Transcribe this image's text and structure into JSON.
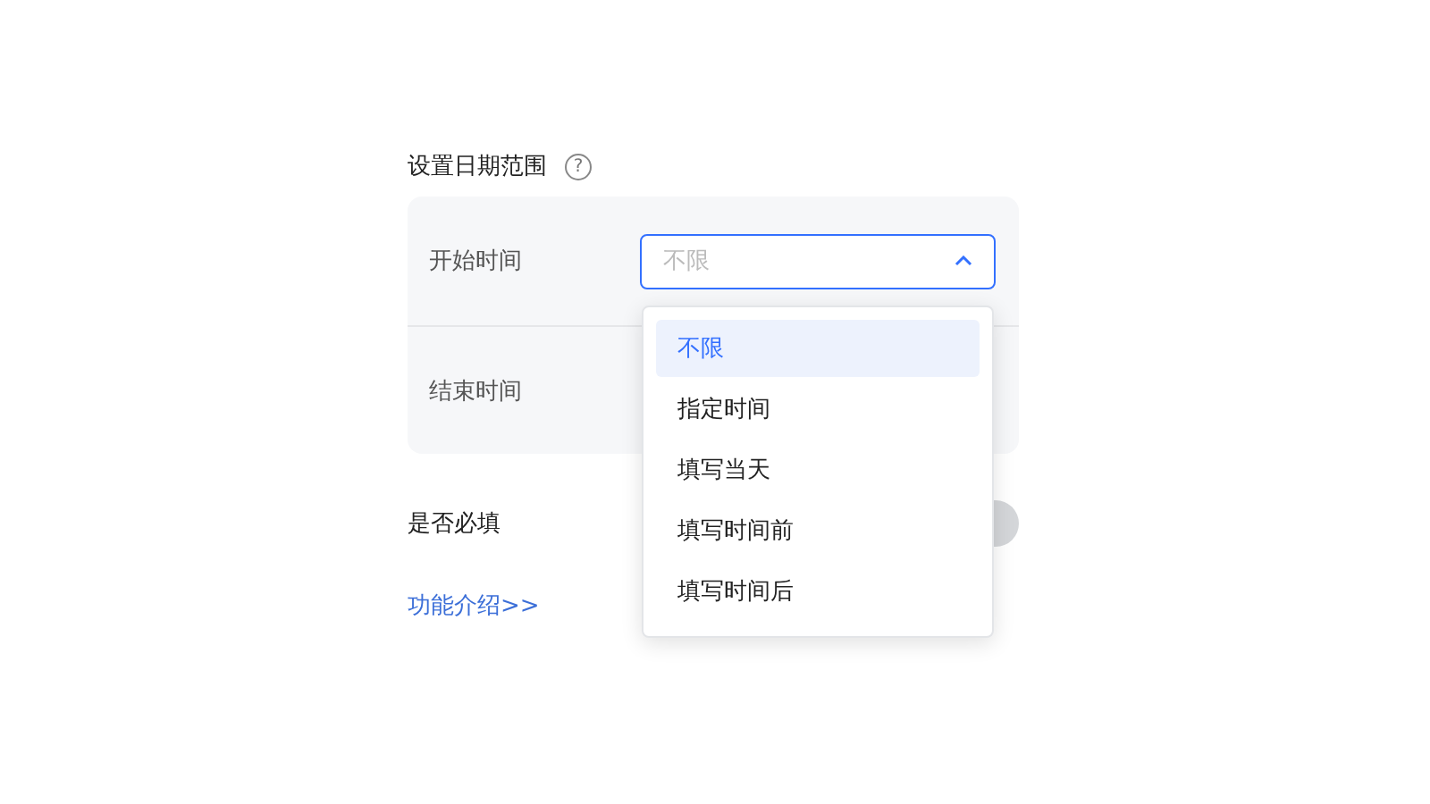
{
  "title": "设置日期范围",
  "help_icon": "?",
  "fields": [
    {
      "label": "开始时间",
      "placeholder": "不限",
      "open": true
    },
    {
      "label": "结束时间"
    }
  ],
  "dropdown": {
    "options": [
      {
        "label": "不限",
        "selected": true
      },
      {
        "label": "指定时间",
        "selected": false
      },
      {
        "label": "填写当天",
        "selected": false
      },
      {
        "label": "填写时间前",
        "selected": false
      },
      {
        "label": "填写时间后",
        "selected": false
      }
    ]
  },
  "required": {
    "label": "是否必填",
    "on": false
  },
  "link": "功能介绍>>"
}
